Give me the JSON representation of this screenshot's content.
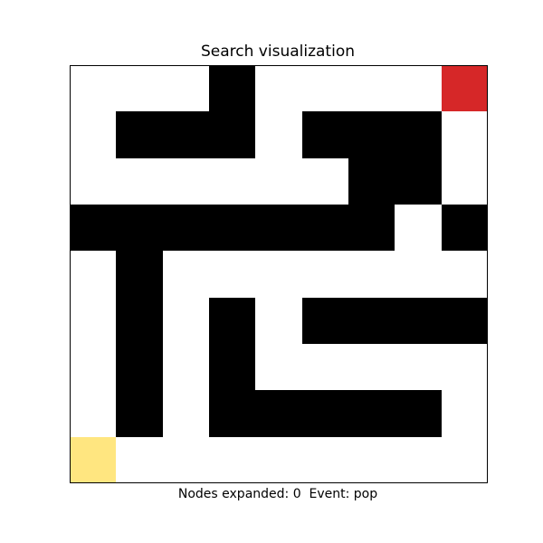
{
  "title": "Search visualization",
  "caption": "Nodes expanded: 0  Event: pop",
  "colors": {
    "wall": "#000000",
    "open": "#ffffff",
    "goal": "#d62728",
    "start": "#ffe680"
  },
  "legend": {
    "#": "wall",
    ".": "open",
    "G": "goal",
    "S": "start"
  },
  "maze": [
    "...#....G",
    ".###.###.",
    "......##.",
    "#######.#",
    ".#.......",
    ".#.#.####",
    ".#.#.....",
    ".#.#####.",
    "S........"
  ]
}
